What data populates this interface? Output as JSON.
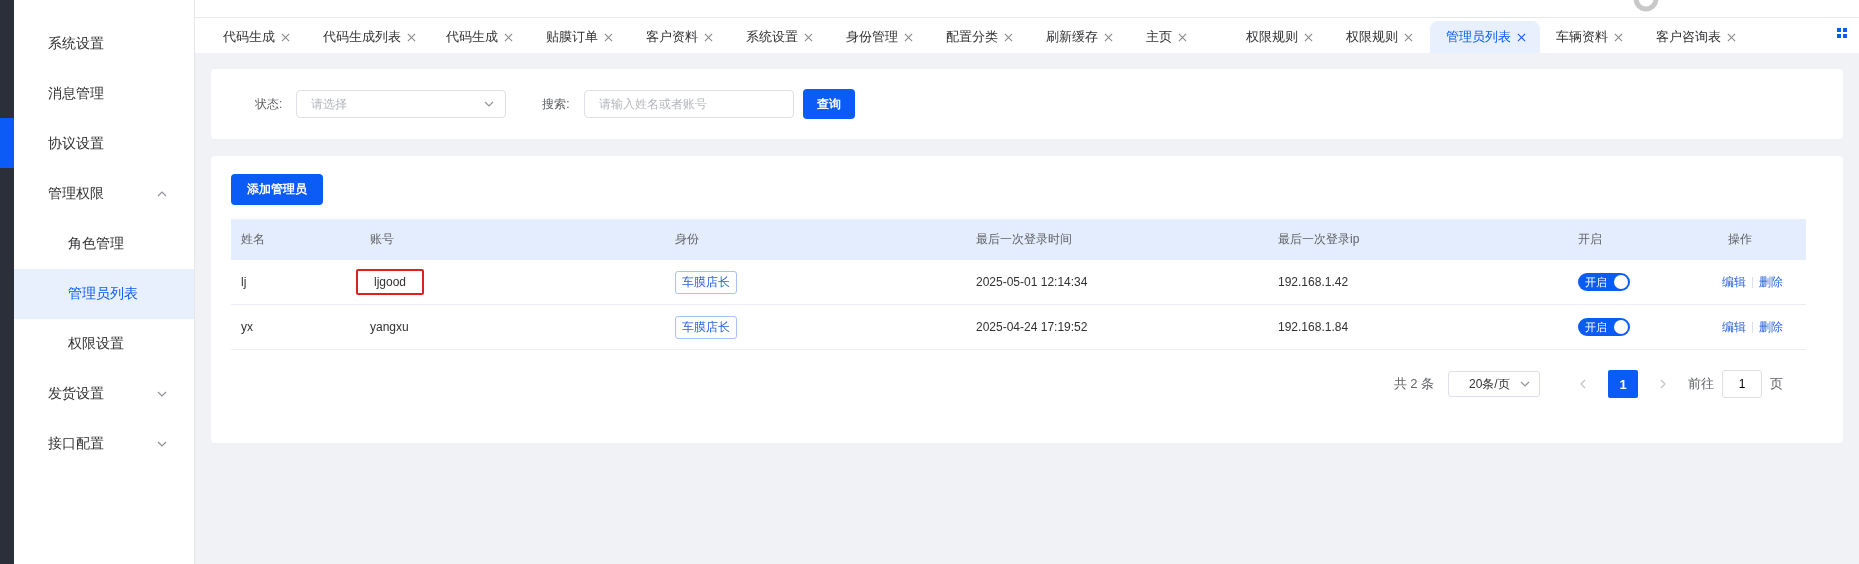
{
  "sidebar": {
    "items": [
      {
        "label": "系统设置",
        "kind": "link",
        "selected": false
      },
      {
        "label": "消息管理",
        "kind": "link",
        "selected": false
      },
      {
        "label": "协议设置",
        "kind": "link",
        "selected": false
      },
      {
        "label": "管理权限",
        "kind": "group",
        "expanded": true,
        "selected": false,
        "children": [
          {
            "label": "角色管理",
            "selected": false
          },
          {
            "label": "管理员列表",
            "selected": true
          },
          {
            "label": "权限设置",
            "selected": false
          }
        ]
      },
      {
        "label": "发货设置",
        "kind": "group",
        "expanded": false,
        "selected": false
      },
      {
        "label": "接口配置",
        "kind": "group",
        "expanded": false,
        "selected": false
      }
    ]
  },
  "tabs": [
    {
      "label": "代码生成",
      "selected": false
    },
    {
      "label": "代码生成列表",
      "selected": false
    },
    {
      "label": "代码生成",
      "selected": false
    },
    {
      "label": "贴膜订单",
      "selected": false
    },
    {
      "label": "客户资料",
      "selected": false
    },
    {
      "label": "系统设置",
      "selected": false
    },
    {
      "label": "身份管理",
      "selected": false
    },
    {
      "label": "配置分类",
      "selected": false
    },
    {
      "label": "刷新缓存",
      "selected": false
    },
    {
      "label": "主页",
      "selected": false
    },
    {
      "label": "权限规则",
      "selected": false
    },
    {
      "label": "权限规则",
      "selected": false
    },
    {
      "label": "管理员列表",
      "selected": true
    },
    {
      "label": "车辆资料",
      "selected": false
    },
    {
      "label": "客户咨询表",
      "selected": false
    }
  ],
  "filter": {
    "status_label": "状态:",
    "status_placeholder": "请选择",
    "search_label": "搜索:",
    "search_placeholder": "请输入姓名或者账号",
    "query_button": "查询"
  },
  "table": {
    "add_button": "添加管理员",
    "columns": [
      "姓名",
      "账号",
      "身份",
      "最后一次登录时间",
      "最后一次登录ip",
      "开启",
      "操作"
    ],
    "rows": [
      {
        "name": "lj",
        "account": "ljgood",
        "account_highlighted": true,
        "role": "车膜店长",
        "last_login_time": "2025-05-01 12:14:34",
        "last_login_ip": "192.168.1.42",
        "enabled": true,
        "enabled_label": "开启",
        "actions": [
          "编辑",
          "删除"
        ]
      },
      {
        "name": "yx",
        "account": "yangxu",
        "account_highlighted": false,
        "role": "车膜店长",
        "last_login_time": "2025-04-24 17:19:52",
        "last_login_ip": "192.168.1.84",
        "enabled": true,
        "enabled_label": "开启",
        "actions": [
          "编辑",
          "删除"
        ]
      }
    ]
  },
  "pagination": {
    "total": "共 2 条",
    "page_size": "20条/页",
    "pages": [
      {
        "label": "1",
        "selected": true
      }
    ],
    "goto_label": "前往",
    "goto_value": "1",
    "page_suffix": "页"
  }
}
